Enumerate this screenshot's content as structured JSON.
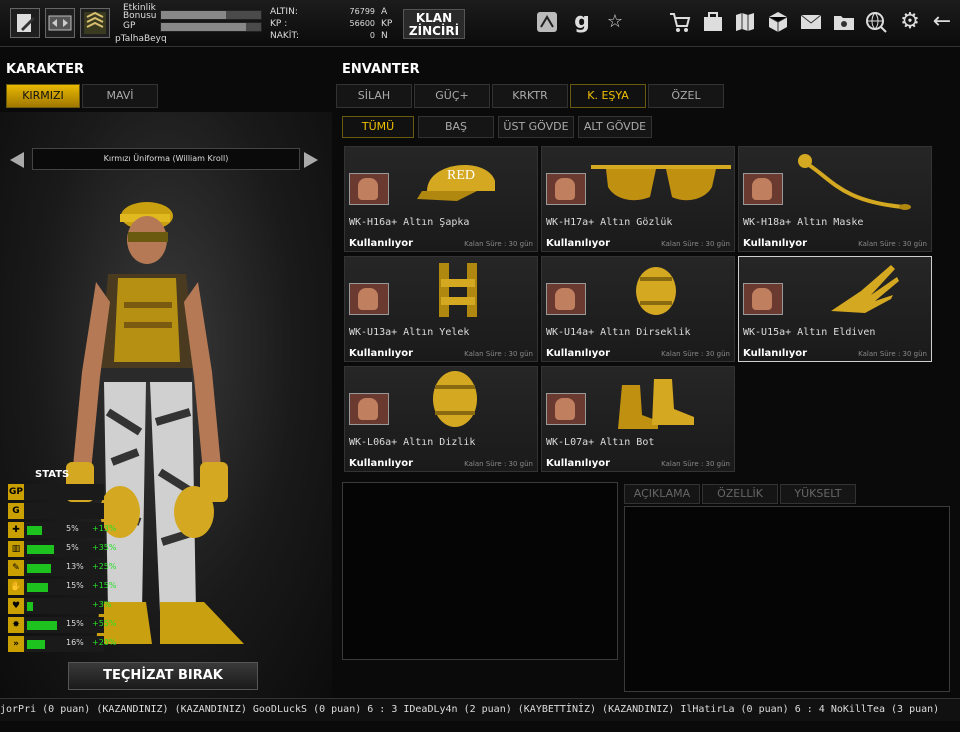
{
  "profile": {
    "etkinlik_label": "Etkinlik",
    "bonusu_label": "Bonusu",
    "gp_label": "GP",
    "username": "pTalhaBeyq",
    "currency_labels": [
      "ALTIN:",
      "KP :",
      "NAKİT:"
    ],
    "currency_values": [
      "76799",
      "56600",
      "0"
    ],
    "currency_units": [
      "A",
      "KP",
      "N"
    ],
    "etkinlik_progress": 0.65,
    "gp_progress": 0.85
  },
  "klan": {
    "line1": "KLAN",
    "line2": "ZİNCİRİ"
  },
  "topicons": [
    "settings-icon",
    "g-icon",
    "star-icon",
    "cart-icon",
    "bag-icon",
    "map-icon",
    "box-icon",
    "mail-icon",
    "folder-icon",
    "globe-icon",
    "gear-icon",
    "back-icon"
  ],
  "karakter": {
    "title": "KARAKTER",
    "tabs": [
      "KIRMIZI",
      "MAVİ"
    ],
    "active_tab": 0,
    "outfit_name": "Kırmızı Üniforma (William Kroll)",
    "stats_title": "STATS",
    "stats": [
      {
        "icon": "GP",
        "pct": "",
        "bonus": "",
        "bar": 0
      },
      {
        "icon": "G",
        "pct": "",
        "bonus": "",
        "bar": 0
      },
      {
        "icon": "✚",
        "pct": "5%",
        "bonus": "+13%",
        "bar": 0.25
      },
      {
        "icon": "▥",
        "pct": "5%",
        "bonus": "+35%",
        "bar": 0.45
      },
      {
        "icon": "✎",
        "pct": "13%",
        "bonus": "+25%",
        "bar": 0.4
      },
      {
        "icon": "✋",
        "pct": "15%",
        "bonus": "+15%",
        "bar": 0.35
      },
      {
        "icon": "♥",
        "pct": "",
        "bonus": "+3%",
        "bar": 0.1
      },
      {
        "icon": "✸",
        "pct": "15%",
        "bonus": "+55%",
        "bar": 0.5
      },
      {
        "icon": "»",
        "pct": "16%",
        "bonus": "+20%",
        "bar": 0.3
      }
    ],
    "drop_button": "TEÇHİZAT BIRAK"
  },
  "envanter": {
    "title": "ENVANTER",
    "tabs": [
      "SİLAH",
      "GÜÇ+",
      "KRKTR",
      "K. EŞYA",
      "ÖZEL"
    ],
    "active_tab": 3,
    "subtabs": [
      "TÜMÜ",
      "BAŞ",
      "ÜST GÖVDE",
      "ALT GÖVDE"
    ],
    "active_subtab": 0,
    "items": [
      {
        "name": "WK-H16a+ Altın Şapka",
        "status": "Kullanılıyor",
        "time": "Kalan Süre : 30 gün",
        "icon": "cap-icon"
      },
      {
        "name": "WK-H17a+ Altın Gözlük",
        "status": "Kullanılıyor",
        "time": "Kalan Süre : 30 gün",
        "icon": "glasses-icon"
      },
      {
        "name": "WK-H18a+ Altın Maske",
        "status": "Kullanılıyor",
        "time": "Kalan Süre : 30 gün",
        "icon": "headset-icon"
      },
      {
        "name": "WK-U13a+ Altın Yelek",
        "status": "Kullanılıyor",
        "time": "Kalan Süre : 30 gün",
        "icon": "vest-icon"
      },
      {
        "name": "WK-U14a+ Altın Dirseklik",
        "status": "Kullanılıyor",
        "time": "Kalan Süre : 30 gün",
        "icon": "elbow-pad-icon"
      },
      {
        "name": "WK-U15a+ Altın Eldiven",
        "status": "Kullanılıyor",
        "time": "Kalan Süre : 30 gün",
        "icon": "glove-icon"
      },
      {
        "name": "WK-L06a+ Altın Dizlik",
        "status": "Kullanılıyor",
        "time": "Kalan Süre : 30 gün",
        "icon": "knee-pad-icon"
      },
      {
        "name": "WK-L07a+ Altın Bot",
        "status": "Kullanılıyor",
        "time": "Kalan Süre : 30 gün",
        "icon": "boots-icon"
      }
    ],
    "selected_item": 5,
    "detail_tabs": [
      "AÇIKLAMA",
      "ÖZELLİK",
      "YÜKSELT"
    ]
  },
  "ticker": "jorPri (0 puan) (KAZANDINIZ)    (KAZANDINIZ) GooDLuckS (0 puan) 6 : 3 IDeaDLy4n (2 puan) (KAYBETTİNİZ)    (KAZANDINIZ) IlHatirLa (0 puan) 6 : 4 NoKillTea (3 puan)"
}
